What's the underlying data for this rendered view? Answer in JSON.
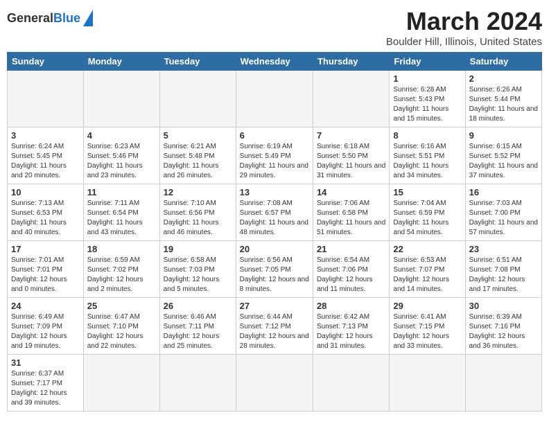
{
  "header": {
    "logo_general": "General",
    "logo_blue": "Blue",
    "title": "March 2024",
    "subtitle": "Boulder Hill, Illinois, United States"
  },
  "weekdays": [
    "Sunday",
    "Monday",
    "Tuesday",
    "Wednesday",
    "Thursday",
    "Friday",
    "Saturday"
  ],
  "weeks": [
    [
      {
        "day": null,
        "info": null
      },
      {
        "day": null,
        "info": null
      },
      {
        "day": null,
        "info": null
      },
      {
        "day": null,
        "info": null
      },
      {
        "day": null,
        "info": null
      },
      {
        "day": "1",
        "info": "Sunrise: 6:28 AM\nSunset: 5:43 PM\nDaylight: 11 hours and 15 minutes."
      },
      {
        "day": "2",
        "info": "Sunrise: 6:26 AM\nSunset: 5:44 PM\nDaylight: 11 hours and 18 minutes."
      }
    ],
    [
      {
        "day": "3",
        "info": "Sunrise: 6:24 AM\nSunset: 5:45 PM\nDaylight: 11 hours and 20 minutes."
      },
      {
        "day": "4",
        "info": "Sunrise: 6:23 AM\nSunset: 5:46 PM\nDaylight: 11 hours and 23 minutes."
      },
      {
        "day": "5",
        "info": "Sunrise: 6:21 AM\nSunset: 5:48 PM\nDaylight: 11 hours and 26 minutes."
      },
      {
        "day": "6",
        "info": "Sunrise: 6:19 AM\nSunset: 5:49 PM\nDaylight: 11 hours and 29 minutes."
      },
      {
        "day": "7",
        "info": "Sunrise: 6:18 AM\nSunset: 5:50 PM\nDaylight: 11 hours and 31 minutes."
      },
      {
        "day": "8",
        "info": "Sunrise: 6:16 AM\nSunset: 5:51 PM\nDaylight: 11 hours and 34 minutes."
      },
      {
        "day": "9",
        "info": "Sunrise: 6:15 AM\nSunset: 5:52 PM\nDaylight: 11 hours and 37 minutes."
      }
    ],
    [
      {
        "day": "10",
        "info": "Sunrise: 7:13 AM\nSunset: 6:53 PM\nDaylight: 11 hours and 40 minutes."
      },
      {
        "day": "11",
        "info": "Sunrise: 7:11 AM\nSunset: 6:54 PM\nDaylight: 11 hours and 43 minutes."
      },
      {
        "day": "12",
        "info": "Sunrise: 7:10 AM\nSunset: 6:56 PM\nDaylight: 11 hours and 46 minutes."
      },
      {
        "day": "13",
        "info": "Sunrise: 7:08 AM\nSunset: 6:57 PM\nDaylight: 11 hours and 48 minutes."
      },
      {
        "day": "14",
        "info": "Sunrise: 7:06 AM\nSunset: 6:58 PM\nDaylight: 11 hours and 51 minutes."
      },
      {
        "day": "15",
        "info": "Sunrise: 7:04 AM\nSunset: 6:59 PM\nDaylight: 11 hours and 54 minutes."
      },
      {
        "day": "16",
        "info": "Sunrise: 7:03 AM\nSunset: 7:00 PM\nDaylight: 11 hours and 57 minutes."
      }
    ],
    [
      {
        "day": "17",
        "info": "Sunrise: 7:01 AM\nSunset: 7:01 PM\nDaylight: 12 hours and 0 minutes."
      },
      {
        "day": "18",
        "info": "Sunrise: 6:59 AM\nSunset: 7:02 PM\nDaylight: 12 hours and 2 minutes."
      },
      {
        "day": "19",
        "info": "Sunrise: 6:58 AM\nSunset: 7:03 PM\nDaylight: 12 hours and 5 minutes."
      },
      {
        "day": "20",
        "info": "Sunrise: 6:56 AM\nSunset: 7:05 PM\nDaylight: 12 hours and 8 minutes."
      },
      {
        "day": "21",
        "info": "Sunrise: 6:54 AM\nSunset: 7:06 PM\nDaylight: 12 hours and 11 minutes."
      },
      {
        "day": "22",
        "info": "Sunrise: 6:53 AM\nSunset: 7:07 PM\nDaylight: 12 hours and 14 minutes."
      },
      {
        "day": "23",
        "info": "Sunrise: 6:51 AM\nSunset: 7:08 PM\nDaylight: 12 hours and 17 minutes."
      }
    ],
    [
      {
        "day": "24",
        "info": "Sunrise: 6:49 AM\nSunset: 7:09 PM\nDaylight: 12 hours and 19 minutes."
      },
      {
        "day": "25",
        "info": "Sunrise: 6:47 AM\nSunset: 7:10 PM\nDaylight: 12 hours and 22 minutes."
      },
      {
        "day": "26",
        "info": "Sunrise: 6:46 AM\nSunset: 7:11 PM\nDaylight: 12 hours and 25 minutes."
      },
      {
        "day": "27",
        "info": "Sunrise: 6:44 AM\nSunset: 7:12 PM\nDaylight: 12 hours and 28 minutes."
      },
      {
        "day": "28",
        "info": "Sunrise: 6:42 AM\nSunset: 7:13 PM\nDaylight: 12 hours and 31 minutes."
      },
      {
        "day": "29",
        "info": "Sunrise: 6:41 AM\nSunset: 7:15 PM\nDaylight: 12 hours and 33 minutes."
      },
      {
        "day": "30",
        "info": "Sunrise: 6:39 AM\nSunset: 7:16 PM\nDaylight: 12 hours and 36 minutes."
      }
    ],
    [
      {
        "day": "31",
        "info": "Sunrise: 6:37 AM\nSunset: 7:17 PM\nDaylight: 12 hours and 39 minutes."
      },
      {
        "day": null,
        "info": null
      },
      {
        "day": null,
        "info": null
      },
      {
        "day": null,
        "info": null
      },
      {
        "day": null,
        "info": null
      },
      {
        "day": null,
        "info": null
      },
      {
        "day": null,
        "info": null
      }
    ]
  ]
}
